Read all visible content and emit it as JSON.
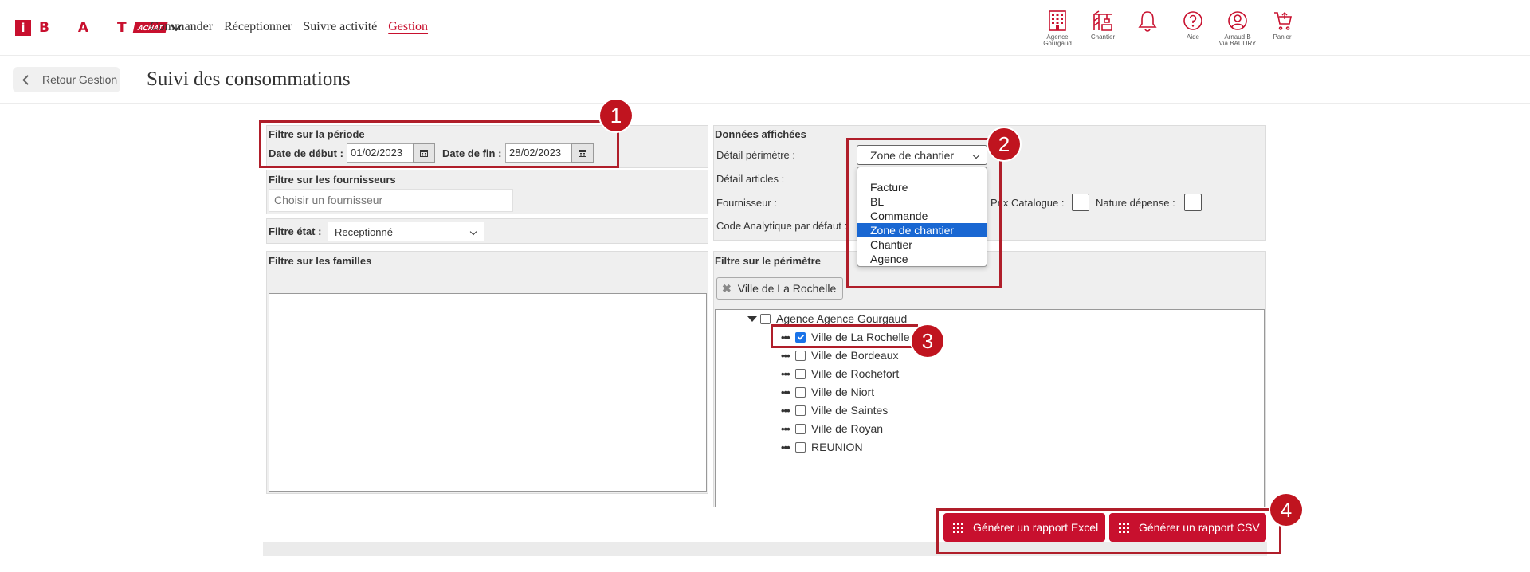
{
  "nav": {
    "brand_letters": "B A T",
    "brand_badge": "ACHAT",
    "items": [
      "Commander",
      "Réceptionner",
      "Suivre activité",
      "Gestion"
    ],
    "active": "Gestion"
  },
  "top_icons": [
    {
      "name": "agence-icon",
      "label": "Agence\nGourgaud"
    },
    {
      "name": "chantier-icon",
      "label": "Chantier"
    },
    {
      "name": "bell-icon",
      "label": ""
    },
    {
      "name": "help-icon",
      "label": "Aide"
    },
    {
      "name": "user-icon",
      "label": "Arnaud B\nVia BAUDRY"
    },
    {
      "name": "cart-icon",
      "label": "Panier"
    }
  ],
  "header": {
    "back_label": "Retour Gestion",
    "title": "Suivi des consommations"
  },
  "periode": {
    "title": "Filtre sur la période",
    "start_label": "Date de début :",
    "start_value": "01/02/2023",
    "end_label": "Date de fin :",
    "end_value": "28/02/2023"
  },
  "fournisseurs": {
    "title": "Filtre sur les fournisseurs",
    "placeholder": "Choisir un fournisseur"
  },
  "etat": {
    "label": "Filtre état :",
    "value": "Receptionné"
  },
  "familles": {
    "title": "Filtre sur les familles"
  },
  "donnees": {
    "title": "Données affichées",
    "perimetre_label": "Détail périmètre :",
    "perimetre_value": "Zone de chantier",
    "articles_label": "Détail articles :",
    "fournisseur_label": "Fournisseur :",
    "prix_label": "Prix Catalogue :",
    "nature_label": "Nature dépense :",
    "analytique_label": "Code Analytique par défaut :",
    "options": [
      "Facture",
      "BL",
      "Commande",
      "Zone de chantier",
      "Chantier",
      "Agence"
    ],
    "selected_option": "Zone de chantier"
  },
  "perimetre": {
    "title": "Filtre sur le périmètre",
    "tag": "Ville de La Rochelle",
    "root": "Agence Agence Gourgaud",
    "items": [
      {
        "label": "Ville de La Rochelle",
        "checked": true
      },
      {
        "label": "Ville de Bordeaux",
        "checked": false
      },
      {
        "label": "Ville de Rochefort",
        "checked": false
      },
      {
        "label": "Ville de Niort",
        "checked": false
      },
      {
        "label": "Ville de Saintes",
        "checked": false
      },
      {
        "label": "Ville de Royan",
        "checked": false
      },
      {
        "label": "REUNION",
        "checked": false
      }
    ]
  },
  "actions": {
    "excel": "Générer un rapport Excel",
    "csv": "Générer un rapport CSV"
  },
  "callouts": [
    "1",
    "2",
    "3",
    "4"
  ],
  "colors": {
    "accent": "#c8102e",
    "callout": "#c0141f",
    "selection": "#1967d2"
  }
}
